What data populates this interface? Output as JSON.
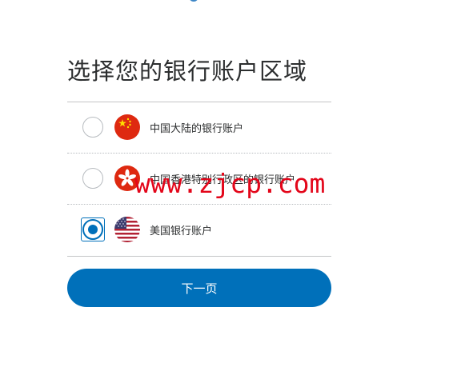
{
  "page": {
    "title": "选择您的银行账户区域"
  },
  "options": [
    {
      "label": "中国大陆的银行账户",
      "flag_icon": "china-flag-icon",
      "selected": false
    },
    {
      "label": "中国香港特别行政区的银行账户",
      "flag_icon": "hong-kong-flag-icon",
      "selected": false
    },
    {
      "label": "美国银行账户",
      "flag_icon": "usa-flag-icon",
      "selected": true
    }
  ],
  "next_button": {
    "label": "下一页"
  },
  "watermark": {
    "text": "www.zjcp.com"
  },
  "colors": {
    "accent": "#0070ba",
    "watermark": "#e3061a",
    "title": "#2c2e2f"
  }
}
